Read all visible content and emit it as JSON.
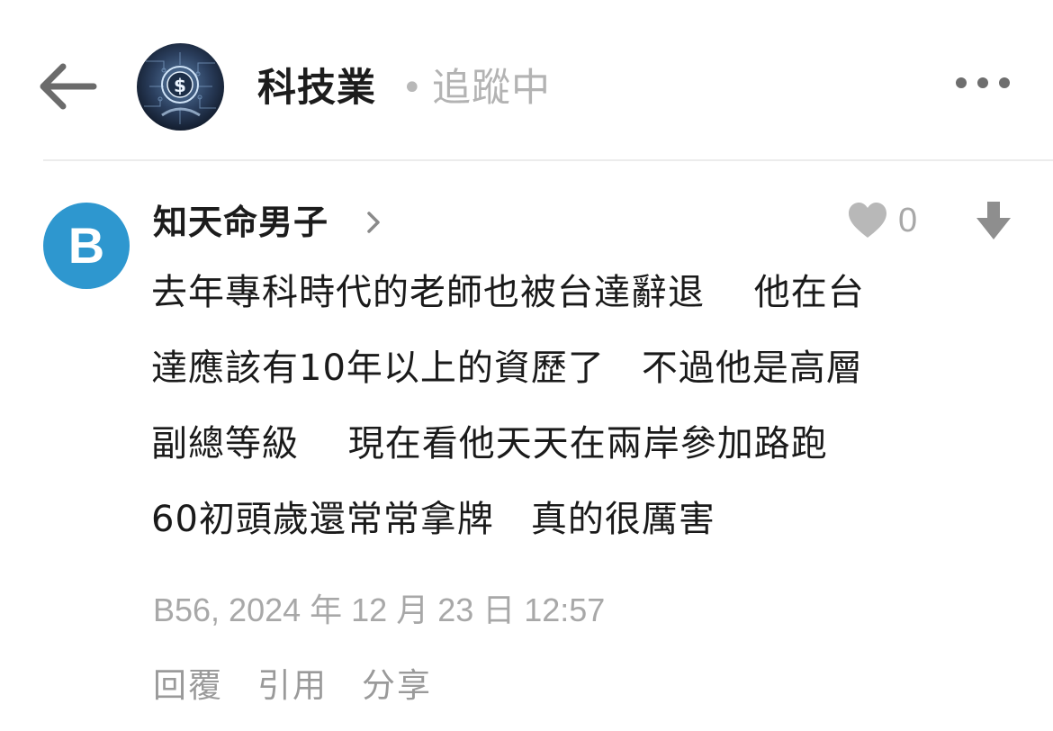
{
  "header": {
    "back_icon": "arrow-left-icon",
    "board_avatar": "fintech-dollar-circuit-image",
    "board_title": "科技業",
    "separator": "•",
    "follow_status": "追蹤中",
    "more_icon": "more-horizontal-icon"
  },
  "comment": {
    "avatar_letter": "B",
    "avatar_color": "#2e97cf",
    "author": "知天命男子",
    "author_chevron_icon": "chevron-right-icon",
    "like_icon": "heart-icon",
    "like_count": "0",
    "dislike_icon": "arrow-down-icon",
    "content_lines": [
      "去年專科時代的老師也被台達辭退　 他在台",
      "達應該有10年以上的資歷了　不過他是高層",
      "副總等級　 現在看他天天在兩岸參加路跑",
      "60初頭歲還常常拿牌　真的很厲害"
    ],
    "meta": "B56, 2024 年 12 月 23 日 12:57",
    "actions": {
      "reply": "回覆",
      "quote": "引用",
      "share": "分享"
    }
  }
}
